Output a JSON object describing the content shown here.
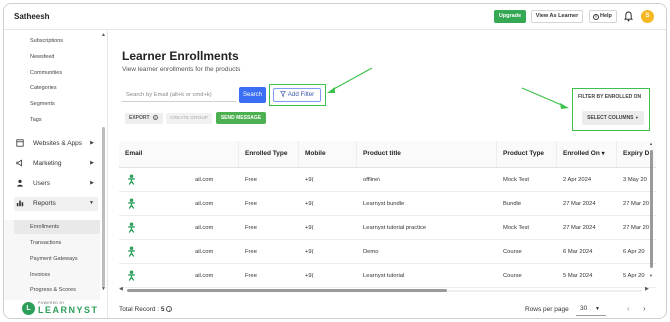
{
  "topbar": {
    "brand": "Satheesh",
    "upgrade_label": "Upgrade",
    "view_as_learner_label": "View As Learner",
    "help_label": "Help",
    "help_icon_glyph": "?",
    "avatar_initial": "S",
    "colors": {
      "upgrade": "#34a853",
      "avatar": "#f6b821"
    }
  },
  "sidebar": {
    "sub_items_top": [
      "Subscriptions",
      "Newsfeed",
      "Communities",
      "Categories",
      "Segments",
      "Tags"
    ],
    "main_items": [
      {
        "label": "Websites & Apps",
        "icon": "website-icon"
      },
      {
        "label": "Marketing",
        "icon": "megaphone-icon"
      },
      {
        "label": "Users",
        "icon": "user-icon"
      },
      {
        "label": "Reports",
        "icon": "chart-icon"
      }
    ],
    "reports_sub_items": [
      "Enrollments",
      "Transactions",
      "Payment Gateways",
      "Invoices",
      "Progress & Scores"
    ],
    "active_item": "Enrollments",
    "logo": {
      "powered_by": "POWERED BY",
      "name": "LEARNYST",
      "mark": "L",
      "color": "#2e9f5a"
    }
  },
  "main": {
    "title": "Learner Enrollments",
    "subtitle": "View learner enrollments for the products",
    "search_placeholder": "Search by Email (alt+k or cmd+k)",
    "search_button": "Search",
    "add_filter_button": "Add Filter",
    "export_button": "EXPORT",
    "create_group_button": "CREATE GROUP",
    "send_message_button": "SEND MESSAGE",
    "filter_by_label": "FILTER BY ENROLLED ON",
    "select_columns_button": "SELECT COLUMNS",
    "accent_color": "#3b6ff3",
    "highlight_color": "#3cc24a"
  },
  "table": {
    "columns": [
      "Email",
      "Enrolled Type",
      "Mobile",
      "Product title",
      "Product Type",
      "Enrolled On",
      "Expiry D"
    ],
    "sort_indicator": "▾",
    "rows": [
      {
        "email": "ail.com",
        "type": "Free",
        "mobile": "+9(",
        "title": "offline\\",
        "product_type": "Mock Test",
        "enrolled_on": "2 Apr 2024",
        "expiry": "3 May 20"
      },
      {
        "email": "ail.com",
        "type": "Free",
        "mobile": "+9(",
        "title": "Learnyst bundle",
        "product_type": "Bundle",
        "enrolled_on": "27 Mar 2024",
        "expiry": "27 Mar 20"
      },
      {
        "email": "ail.com",
        "type": "Free",
        "mobile": "+9(",
        "title": "Learnyst tutorial practice",
        "product_type": "Mock Test",
        "enrolled_on": "27 Mar 2024",
        "expiry": "27 Mar 20"
      },
      {
        "email": "ail.com",
        "type": "Free",
        "mobile": "+9(",
        "title": "Demo",
        "product_type": "Course",
        "enrolled_on": "6 Mar 2024",
        "expiry": "6 Apr 20"
      },
      {
        "email": "ail.com",
        "type": "Free",
        "mobile": "+9(",
        "title": "Learnyst tutorial",
        "product_type": "Course",
        "enrolled_on": "5 Mar 2024",
        "expiry": "5 Apr 20"
      }
    ]
  },
  "footer": {
    "total_label": "Total Record :",
    "total_value": "5",
    "rows_per_page_label": "Rows per page",
    "rows_per_page_value": "30"
  }
}
